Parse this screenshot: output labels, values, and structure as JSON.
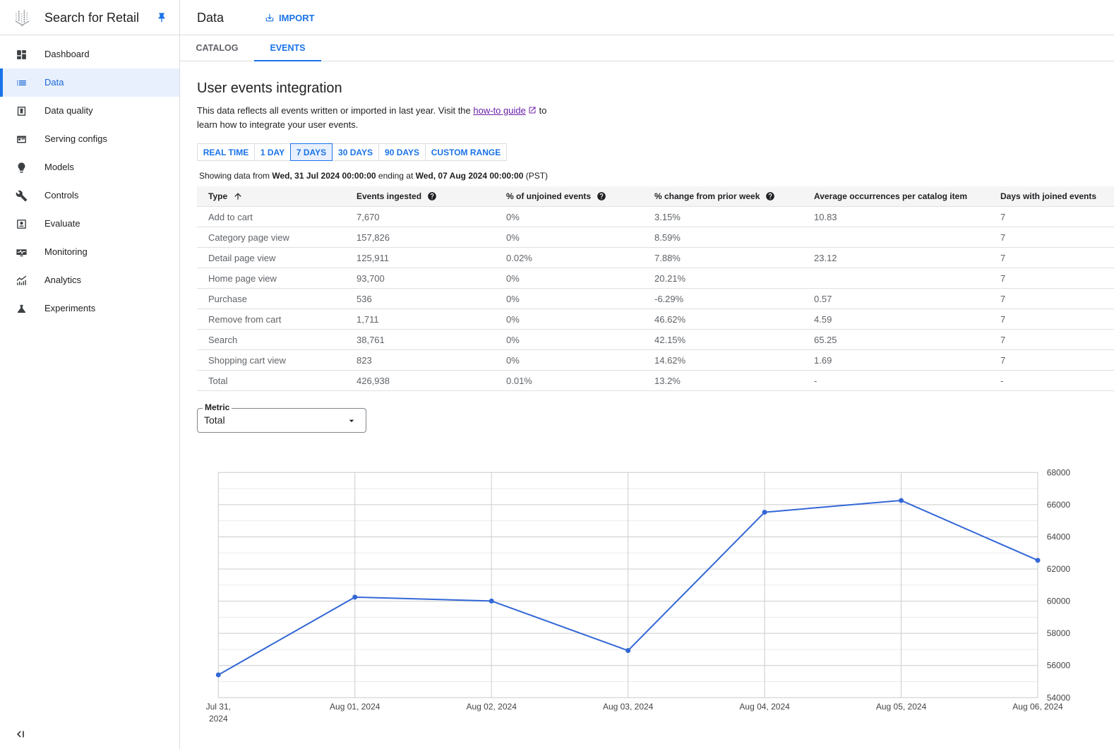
{
  "app": {
    "title": "Search for Retail"
  },
  "sidebar": {
    "items": [
      {
        "label": "Dashboard",
        "icon": "dashboard-icon",
        "active": false
      },
      {
        "label": "Data",
        "icon": "list-icon",
        "active": true
      },
      {
        "label": "Data quality",
        "icon": "data-quality-icon",
        "active": false
      },
      {
        "label": "Serving configs",
        "icon": "serving-configs-icon",
        "active": false
      },
      {
        "label": "Models",
        "icon": "lightbulb-icon",
        "active": false
      },
      {
        "label": "Controls",
        "icon": "wrench-icon",
        "active": false
      },
      {
        "label": "Evaluate",
        "icon": "evaluate-icon",
        "active": false
      },
      {
        "label": "Monitoring",
        "icon": "monitoring-icon",
        "active": false
      },
      {
        "label": "Analytics",
        "icon": "analytics-icon",
        "active": false
      },
      {
        "label": "Experiments",
        "icon": "flask-icon",
        "active": false
      }
    ]
  },
  "header": {
    "title": "Data",
    "import_label": "IMPORT"
  },
  "tabs": [
    {
      "label": "CATALOG",
      "active": false
    },
    {
      "label": "EVENTS",
      "active": true
    }
  ],
  "section": {
    "title": "User events integration",
    "description_prefix": "This data reflects all events written or imported in last year. Visit the ",
    "link_text": "how-to guide",
    "description_suffix": " to learn how to integrate your user events."
  },
  "time_ranges": {
    "options": [
      "REAL T﻿IME",
      "1 DAY",
      "7 DAYS",
      "30 DAYS",
      "90 DAYS",
      "CUSTOM RANGE"
    ],
    "selected": "7 DAYS"
  },
  "date_range": {
    "prefix": "Showing data from ",
    "start": "Wed, 31 Jul 2024 00:00:00",
    "middle": " ending at ",
    "end": "Wed, 07 Aug 2024 00:00:00",
    "timezone": " (PST)"
  },
  "table": {
    "columns": [
      {
        "label": "Type",
        "sort": "ascending",
        "help": false
      },
      {
        "label": "Events ingested",
        "help": true
      },
      {
        "label": "% of unjoined events",
        "help": true
      },
      {
        "label": "% change from prior week",
        "help": true
      },
      {
        "label": "Average occurrences per catalog item",
        "help": false
      },
      {
        "label": "Days with joined events",
        "help": false
      }
    ],
    "rows": [
      [
        "Add to cart",
        "7,670",
        "0%",
        "3.15%",
        "10.83",
        "7"
      ],
      [
        "Category page view",
        "157,826",
        "0%",
        "8.59%",
        "",
        "7"
      ],
      [
        "Detail page view",
        "125,911",
        "0.02%",
        "7.88%",
        "23.12",
        "7"
      ],
      [
        "Home page view",
        "93,700",
        "0%",
        "20.21%",
        "",
        "7"
      ],
      [
        "Purchase",
        "536",
        "0%",
        "-6.29%",
        "0.57",
        "7"
      ],
      [
        "Remove from cart",
        "1,711",
        "0%",
        "46.62%",
        "4.59",
        "7"
      ],
      [
        "Search",
        "38,761",
        "0%",
        "42.15%",
        "65.25",
        "7"
      ],
      [
        "Shopping cart view",
        "823",
        "0%",
        "14.62%",
        "1.69",
        "7"
      ],
      [
        "Total",
        "426,938",
        "0.01%",
        "13.2%",
        "-",
        "-"
      ]
    ]
  },
  "metric": {
    "label": "Metric",
    "value": "Total"
  },
  "colors": {
    "accent": "#1a73e8",
    "active_nav_bg": "#e8f0fe",
    "link_visited": "#681da8",
    "chart_line": "#3367d6"
  },
  "chart_data": {
    "type": "line",
    "title": "",
    "xlabel": "",
    "ylabel": "",
    "categories": [
      "Jul 31, 2024",
      "Aug 01, 2024",
      "Aug 02, 2024",
      "Aug 03, 2024",
      "Aug 04, 2024",
      "Aug 05, 2024",
      "Aug 06, 2024"
    ],
    "series": [
      {
        "name": "Total",
        "values": [
          55420,
          60250,
          60010,
          56930,
          65530,
          66260,
          62540
        ],
        "color": "#3367d6"
      }
    ],
    "ylim": [
      54000,
      68000
    ],
    "yticks": [
      54000,
      56000,
      58000,
      60000,
      62000,
      64000,
      66000,
      68000
    ],
    "y_minor_gridline_step": 1000,
    "y_axis_side": "right",
    "grid": true,
    "markers": true,
    "legend": "none"
  }
}
